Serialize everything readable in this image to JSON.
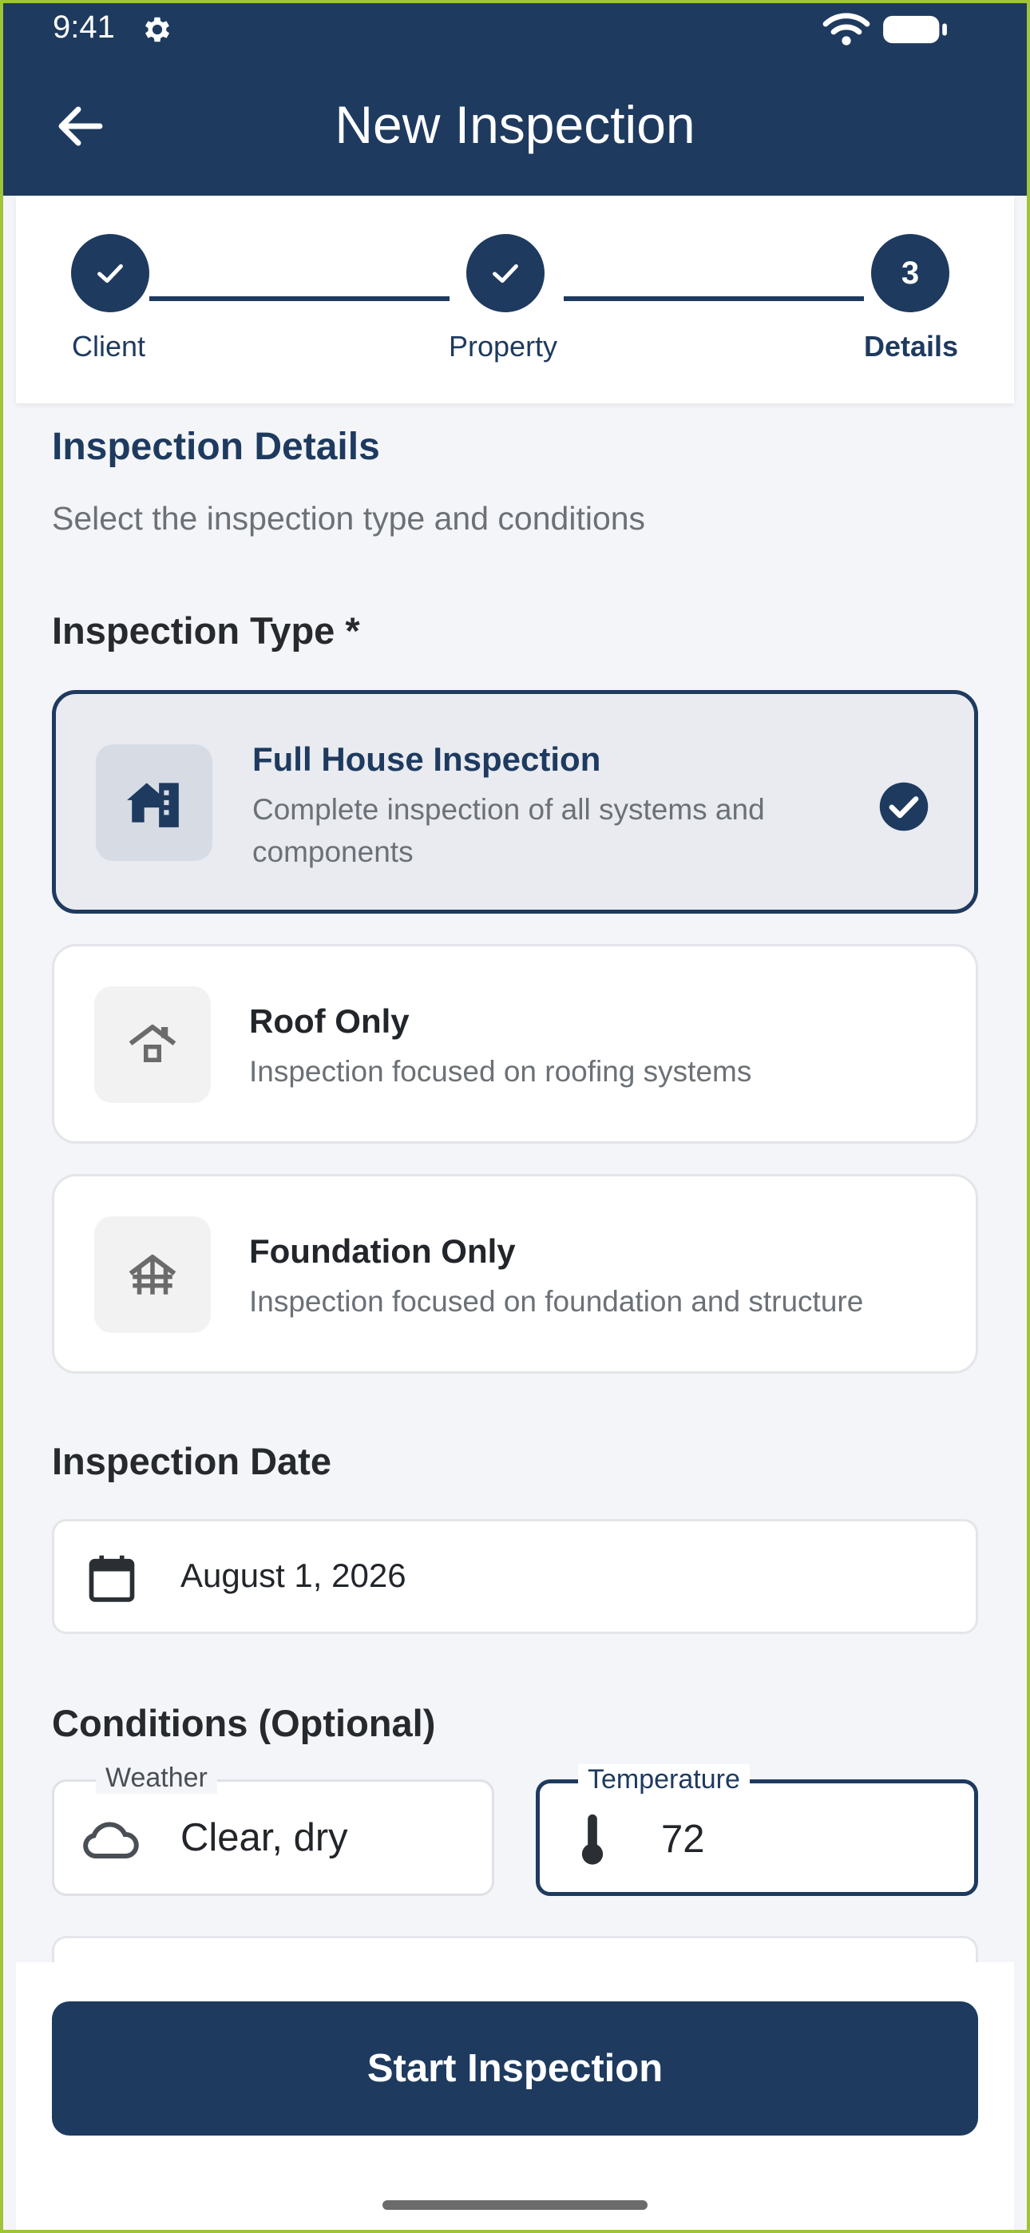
{
  "status_bar": {
    "time": "9:41"
  },
  "app_bar": {
    "title": "New Inspection"
  },
  "stepper": {
    "steps": [
      {
        "label": "Client",
        "state": "done"
      },
      {
        "label": "Property",
        "state": "done"
      },
      {
        "label": "Details",
        "state": "current",
        "number": "3"
      }
    ]
  },
  "section": {
    "title": "Inspection Details",
    "subtitle": "Select the inspection type and conditions"
  },
  "inspection_type": {
    "label": "Inspection Type *",
    "options": [
      {
        "title": "Full House Inspection",
        "description": "Complete inspection of all systems and components",
        "selected": true,
        "icon": "house-icon"
      },
      {
        "title": "Roof Only",
        "description": "Inspection focused on roofing systems",
        "selected": false,
        "icon": "roof-icon"
      },
      {
        "title": "Foundation Only",
        "description": "Inspection focused on foundation and structure",
        "selected": false,
        "icon": "foundation-icon"
      }
    ]
  },
  "inspection_date": {
    "label": "Inspection Date",
    "value": "August 1, 2026",
    "icon": "calendar-icon"
  },
  "conditions": {
    "label": "Conditions (Optional)",
    "weather": {
      "label": "Weather",
      "value": "Clear, dry",
      "icon": "cloud-icon"
    },
    "temperature": {
      "label": "Temperature",
      "value": "72",
      "icon": "thermometer-icon"
    }
  },
  "actions": {
    "start_label": "Start Inspection"
  },
  "colors": {
    "primary": "#1e3a5f",
    "background": "#f4f5f8",
    "muted_text": "#6b7177"
  }
}
